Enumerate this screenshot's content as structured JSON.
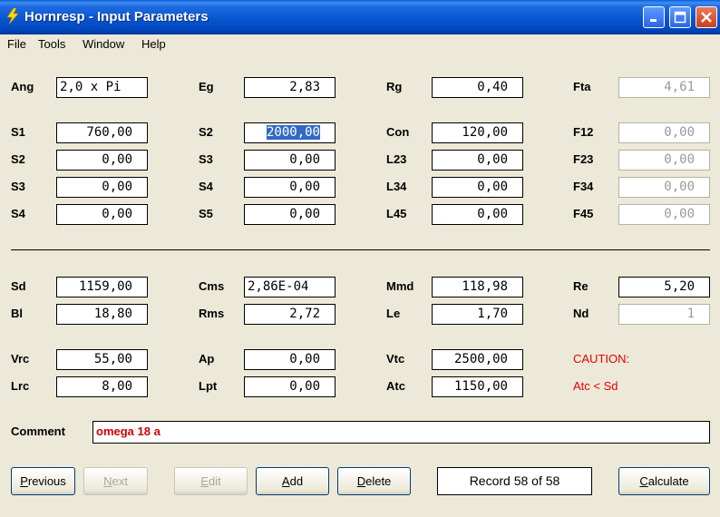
{
  "window": {
    "title": "Hornresp - Input Parameters"
  },
  "menu": [
    "File",
    "Tools",
    "Window",
    "Help"
  ],
  "params": {
    "row1": [
      {
        "label": "Ang",
        "value": "2,0 x Pi"
      },
      {
        "label": "Eg",
        "value": "2,83"
      },
      {
        "label": "Rg",
        "value": "0,40"
      },
      {
        "label": "Fta",
        "value": "4,61"
      }
    ],
    "row2": [
      {
        "label": "S1",
        "value": "760,00"
      },
      {
        "label": "S2",
        "value": "2000,00"
      },
      {
        "label": "Con",
        "value": "120,00"
      },
      {
        "label": "F12",
        "value": "0,00"
      }
    ],
    "row3": [
      {
        "label": "S2",
        "value": "0,00"
      },
      {
        "label": "S3",
        "value": "0,00"
      },
      {
        "label": "L23",
        "value": "0,00"
      },
      {
        "label": "F23",
        "value": "0,00"
      }
    ],
    "row4": [
      {
        "label": "S3",
        "value": "0,00"
      },
      {
        "label": "S4",
        "value": "0,00"
      },
      {
        "label": "L34",
        "value": "0,00"
      },
      {
        "label": "F34",
        "value": "0,00"
      }
    ],
    "row5": [
      {
        "label": "S4",
        "value": "0,00"
      },
      {
        "label": "S5",
        "value": "0,00"
      },
      {
        "label": "L45",
        "value": "0,00"
      },
      {
        "label": "F45",
        "value": "0,00"
      }
    ],
    "row6": [
      {
        "label": "Sd",
        "value": "1159,00"
      },
      {
        "label": "Cms",
        "value": "2,86E-04"
      },
      {
        "label": "Mmd",
        "value": "118,98"
      },
      {
        "label": "Re",
        "value": "5,20"
      }
    ],
    "row7": [
      {
        "label": "Bl",
        "value": "18,80"
      },
      {
        "label": "Rms",
        "value": "2,72"
      },
      {
        "label": "Le",
        "value": "1,70"
      },
      {
        "label": "Nd",
        "value": "1"
      }
    ],
    "row8": [
      {
        "label": "Vrc",
        "value": "55,00"
      },
      {
        "label": "Ap",
        "value": "0,00"
      },
      {
        "label": "Vtc",
        "value": "2500,00"
      }
    ],
    "row9": [
      {
        "label": "Lrc",
        "value": "8,00"
      },
      {
        "label": "Lpt",
        "value": "0,00"
      },
      {
        "label": "Atc",
        "value": "1150,00"
      }
    ]
  },
  "caution": {
    "title": "CAUTION:",
    "message": "Atc < Sd"
  },
  "comment": {
    "label": "Comment",
    "value": "omega 18 a"
  },
  "buttons": {
    "previous": {
      "first": "P",
      "rest": "revious"
    },
    "next": {
      "first": "N",
      "rest": "ext"
    },
    "edit": {
      "first": "E",
      "rest": "dit"
    },
    "add": {
      "first": "A",
      "rest": "dd"
    },
    "delete": {
      "first": "D",
      "rest": "elete"
    },
    "calculate": {
      "first": "C",
      "rest": "alculate"
    }
  },
  "record": "Record 58 of 58",
  "colors": {
    "title_bar": "#0a56d0",
    "caution": "#e60000",
    "comment_text": "#d40000",
    "selection": "#316ac5"
  }
}
